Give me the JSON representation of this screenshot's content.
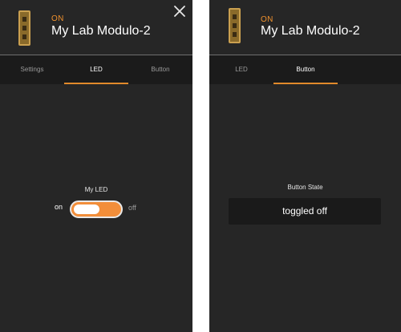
{
  "left_panel": {
    "header": {
      "status": "ON",
      "title": "My Lab Modulo-2"
    },
    "tabs": [
      {
        "label": "Settings",
        "active": false
      },
      {
        "label": "LED",
        "active": true
      },
      {
        "label": "Button",
        "active": false
      }
    ],
    "led": {
      "label": "My LED",
      "on_label": "on",
      "off_label": "off",
      "state": "on"
    }
  },
  "right_panel": {
    "header": {
      "status": "ON",
      "title": "My Lab Modulo-2"
    },
    "tabs": [
      {
        "label": "LED",
        "active": false
      },
      {
        "label": "Button",
        "active": true
      }
    ],
    "button": {
      "label": "Button State",
      "value": "toggled off"
    }
  },
  "colors": {
    "accent": "#f28e3a",
    "panel_bg": "#262626",
    "tab_bar_bg": "#1b1b1b"
  },
  "icons": {
    "device": "device-module-icon",
    "close": "close-icon"
  }
}
